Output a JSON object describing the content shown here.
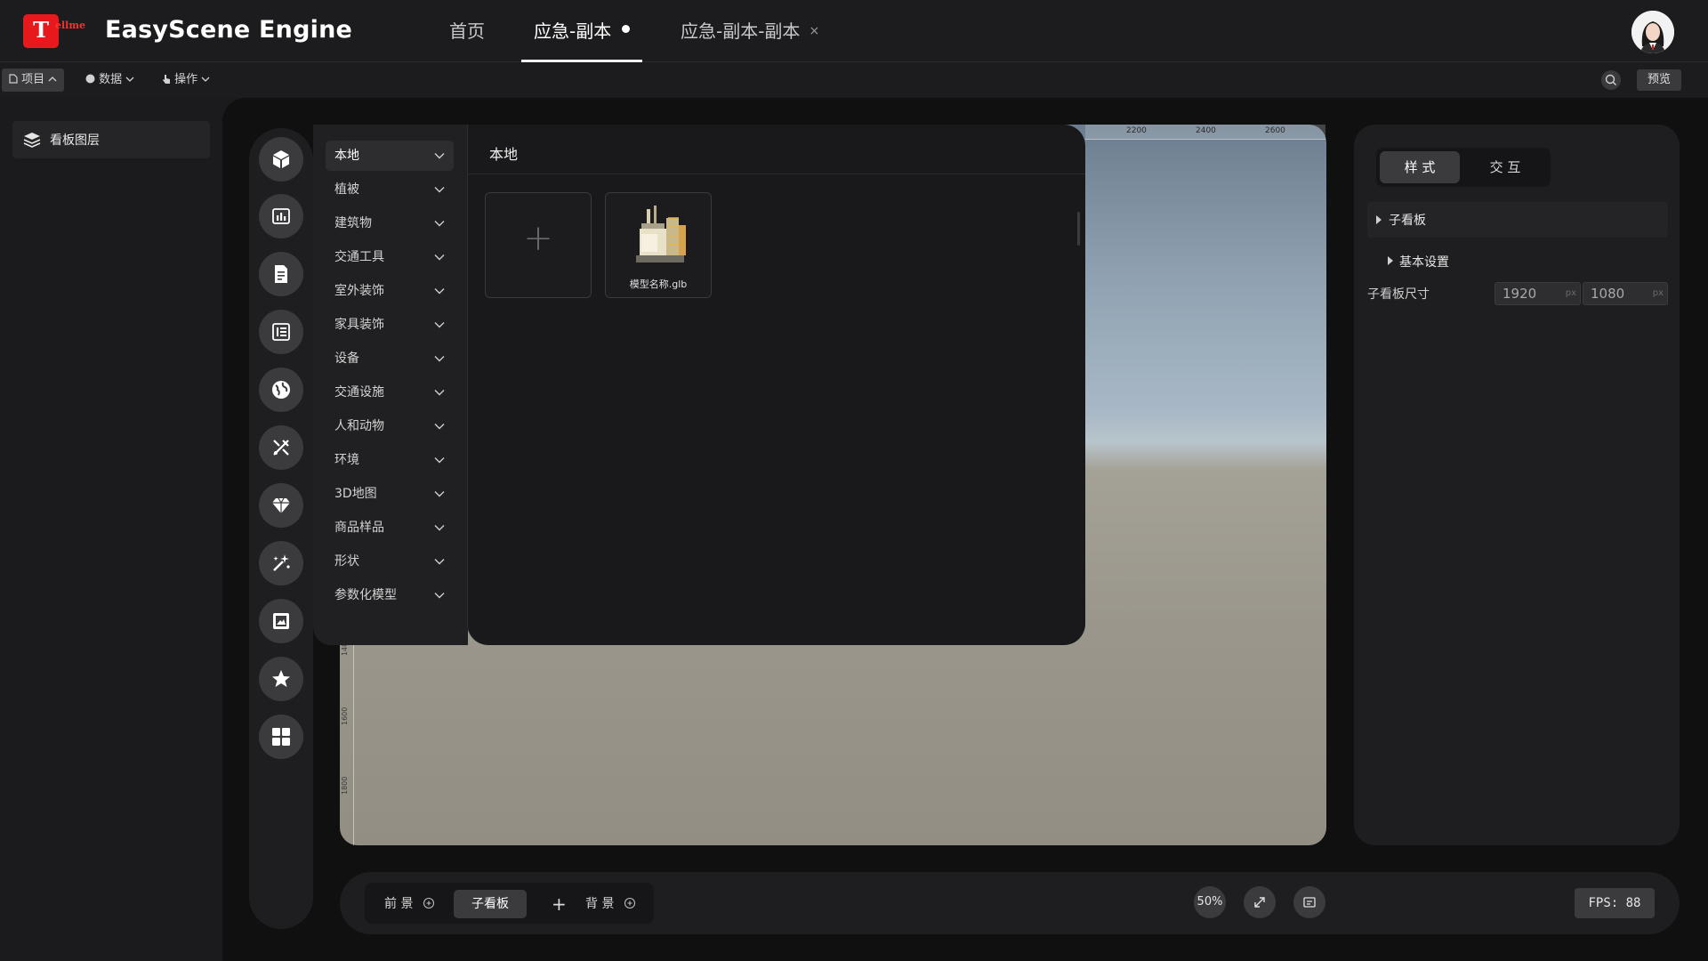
{
  "app": {
    "logo_letter": "T",
    "logo_sub": "ellme",
    "title": "EasyScene Engine"
  },
  "tabs": [
    {
      "label": "首页"
    },
    {
      "label": "应急-副本"
    },
    {
      "label": "应急-副本-副本",
      "close": "×"
    }
  ],
  "menubar": {
    "project": "项目",
    "data": "数据",
    "operate": "操作",
    "preview": "预览"
  },
  "left_panel": {
    "layers_label": "看板图层"
  },
  "rail_icons": [
    "cube-icon",
    "bar-chart-icon",
    "document-icon",
    "tree-list-icon",
    "globe-icon",
    "tools-icon",
    "diamond-icon",
    "sparkle-icon",
    "image-frame-icon",
    "star-icon",
    "grid-icon"
  ],
  "categories": [
    {
      "label": "本地",
      "active": true
    },
    {
      "label": "植被"
    },
    {
      "label": "建筑物"
    },
    {
      "label": "交通工具"
    },
    {
      "label": "室外装饰"
    },
    {
      "label": "家具装饰"
    },
    {
      "label": "设备"
    },
    {
      "label": "交通设施"
    },
    {
      "label": "人和动物"
    },
    {
      "label": "环境"
    },
    {
      "label": "3D地图"
    },
    {
      "label": "商品样品"
    },
    {
      "label": "形状"
    },
    {
      "label": "参数化模型"
    }
  ],
  "assets": {
    "title": "本地",
    "add_symbol": "+",
    "items": [
      {
        "name": "模型名称.glb"
      }
    ]
  },
  "ruler": {
    "top": [
      "2200",
      "2400",
      "2600"
    ],
    "left": [
      "1400",
      "1600",
      "1800"
    ]
  },
  "right_panel": {
    "tabs": [
      {
        "label": "样 式"
      },
      {
        "label": "交 互"
      }
    ],
    "section_child": "子看板",
    "section_basic": "基本设置",
    "size_label": "子看板尺寸",
    "width_value": "1920",
    "height_value": "1080",
    "unit": "px"
  },
  "bottom": {
    "foreground": "前 景",
    "child_board": "子看板",
    "add": "+",
    "background": "背 景",
    "zoom": "50%",
    "fps": "FPS: 88"
  },
  "colors": {
    "brand_red": "#e8191c",
    "panel": "#1e1e20",
    "workspace": "#101011"
  }
}
